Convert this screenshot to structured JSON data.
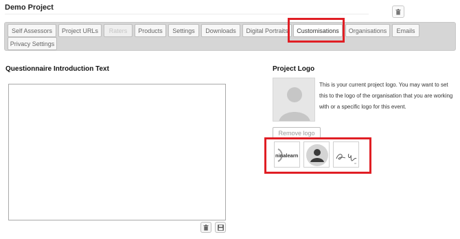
{
  "header": {
    "title": "Demo Project"
  },
  "tabs": [
    {
      "label": "Self Assessors",
      "state": "normal"
    },
    {
      "label": "Project URLs",
      "state": "normal"
    },
    {
      "label": "Raters",
      "state": "disabled"
    },
    {
      "label": "Products",
      "state": "normal"
    },
    {
      "label": "Settings",
      "state": "normal"
    },
    {
      "label": "Downloads",
      "state": "normal"
    },
    {
      "label": "Digital Portraits",
      "state": "normal"
    },
    {
      "label": "Customisations",
      "state": "active"
    },
    {
      "label": "Organisations",
      "state": "normal"
    },
    {
      "label": "Emails",
      "state": "normal"
    },
    {
      "label": "Privacy Settings",
      "state": "normal"
    }
  ],
  "questionnaire": {
    "heading": "Questionnaire Introduction Text",
    "text_value": ""
  },
  "project_logo": {
    "heading": "Project Logo",
    "description": "This is your current project logo. You may want to set this to the logo of the organisation that you are working with or a specific logo for this event.",
    "remove_label": "Remove logo",
    "thumbnails": [
      "ninalearn-logo",
      "default-avatar",
      "signature"
    ],
    "thumbnail_text": {
      "ninalearn": "ninalearn"
    }
  },
  "icons": {
    "trash": "trash-icon",
    "save": "save-icon"
  },
  "colors": {
    "highlight": "#e01e24",
    "tab_bar": "#d6d6d6"
  }
}
